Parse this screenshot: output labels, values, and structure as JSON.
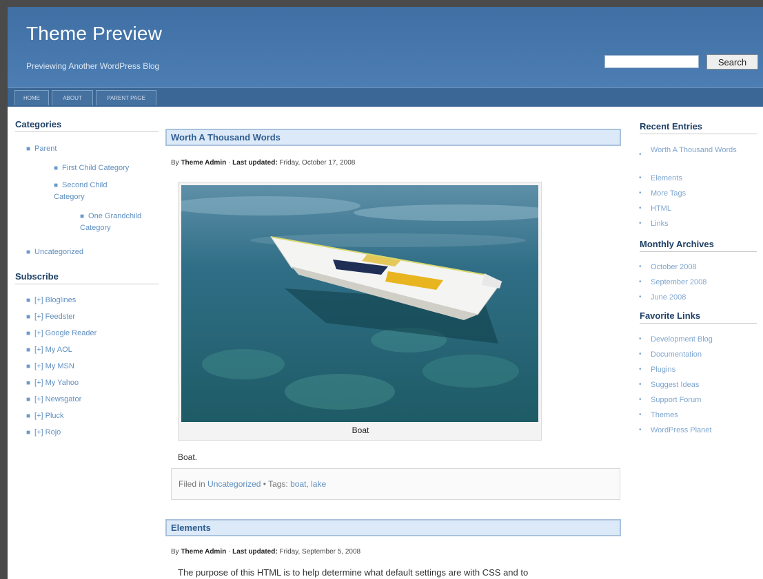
{
  "header": {
    "title": "Theme Preview",
    "description": "Previewing Another WordPress Blog",
    "search_button": "Search",
    "search_placeholder": ""
  },
  "nav": {
    "tabs": [
      "HOME",
      "ABOUT",
      "PARENT PAGE"
    ]
  },
  "left_sidebar": {
    "categories_heading": "Categories",
    "categories": [
      {
        "label": "Parent"
      },
      {
        "label": "First Child Category"
      },
      {
        "label": "Second Child Category"
      },
      {
        "label": "One Grandchild Category"
      },
      {
        "label": "Uncategorized"
      }
    ],
    "subscribe_heading": "Subscribe",
    "subscribe_plus": "[+]",
    "subscribe_items": [
      "Bloglines",
      "Feedster",
      "Google Reader",
      "My AOL",
      "My MSN",
      "My Yahoo",
      "Newsgator",
      "Pluck",
      "Rojo"
    ]
  },
  "main": {
    "post1": {
      "title": "Worth A Thousand Words",
      "byline_by": "By",
      "byline_author": "Theme Admin",
      "byline_sep": "·",
      "byline_updated_label": "Last updated:",
      "byline_date": "Friday, October 17, 2008",
      "image_caption": "Boat",
      "body": "Boat.",
      "filed_in_label": "Filed in",
      "filed_category": "Uncategorized",
      "tags_label": "• Tags:",
      "tags": "boat, lake"
    },
    "post2": {
      "title": "Elements",
      "byline_by": "By",
      "byline_author": "Theme Admin",
      "byline_sep": "·",
      "byline_updated_label": "Last updated:",
      "byline_date": "Friday, September 5, 2008",
      "body_start": "The purpose of this HTML is to help determine what default settings are with CSS and to"
    }
  },
  "right_sidebar": {
    "recent_heading": "Recent Entries",
    "recent_items": [
      "Worth A Thousand Words",
      "Elements",
      "More Tags",
      "HTML",
      "Links"
    ],
    "archives_heading": "Monthly Archives",
    "archive_items": [
      "October 2008",
      "September 2008",
      "June 2008"
    ],
    "links_heading": "Favorite Links",
    "link_items": [
      "Development Blog",
      "Documentation",
      "Plugins",
      "Suggest Ideas",
      "Support Forum",
      "Themes",
      "WordPress Planet"
    ]
  },
  "colors": {
    "header_blue": "#4a7aaf",
    "nav_blue": "#3b6796",
    "link_blue": "#5f8fc0",
    "title_box_bg": "#dce9f8"
  }
}
